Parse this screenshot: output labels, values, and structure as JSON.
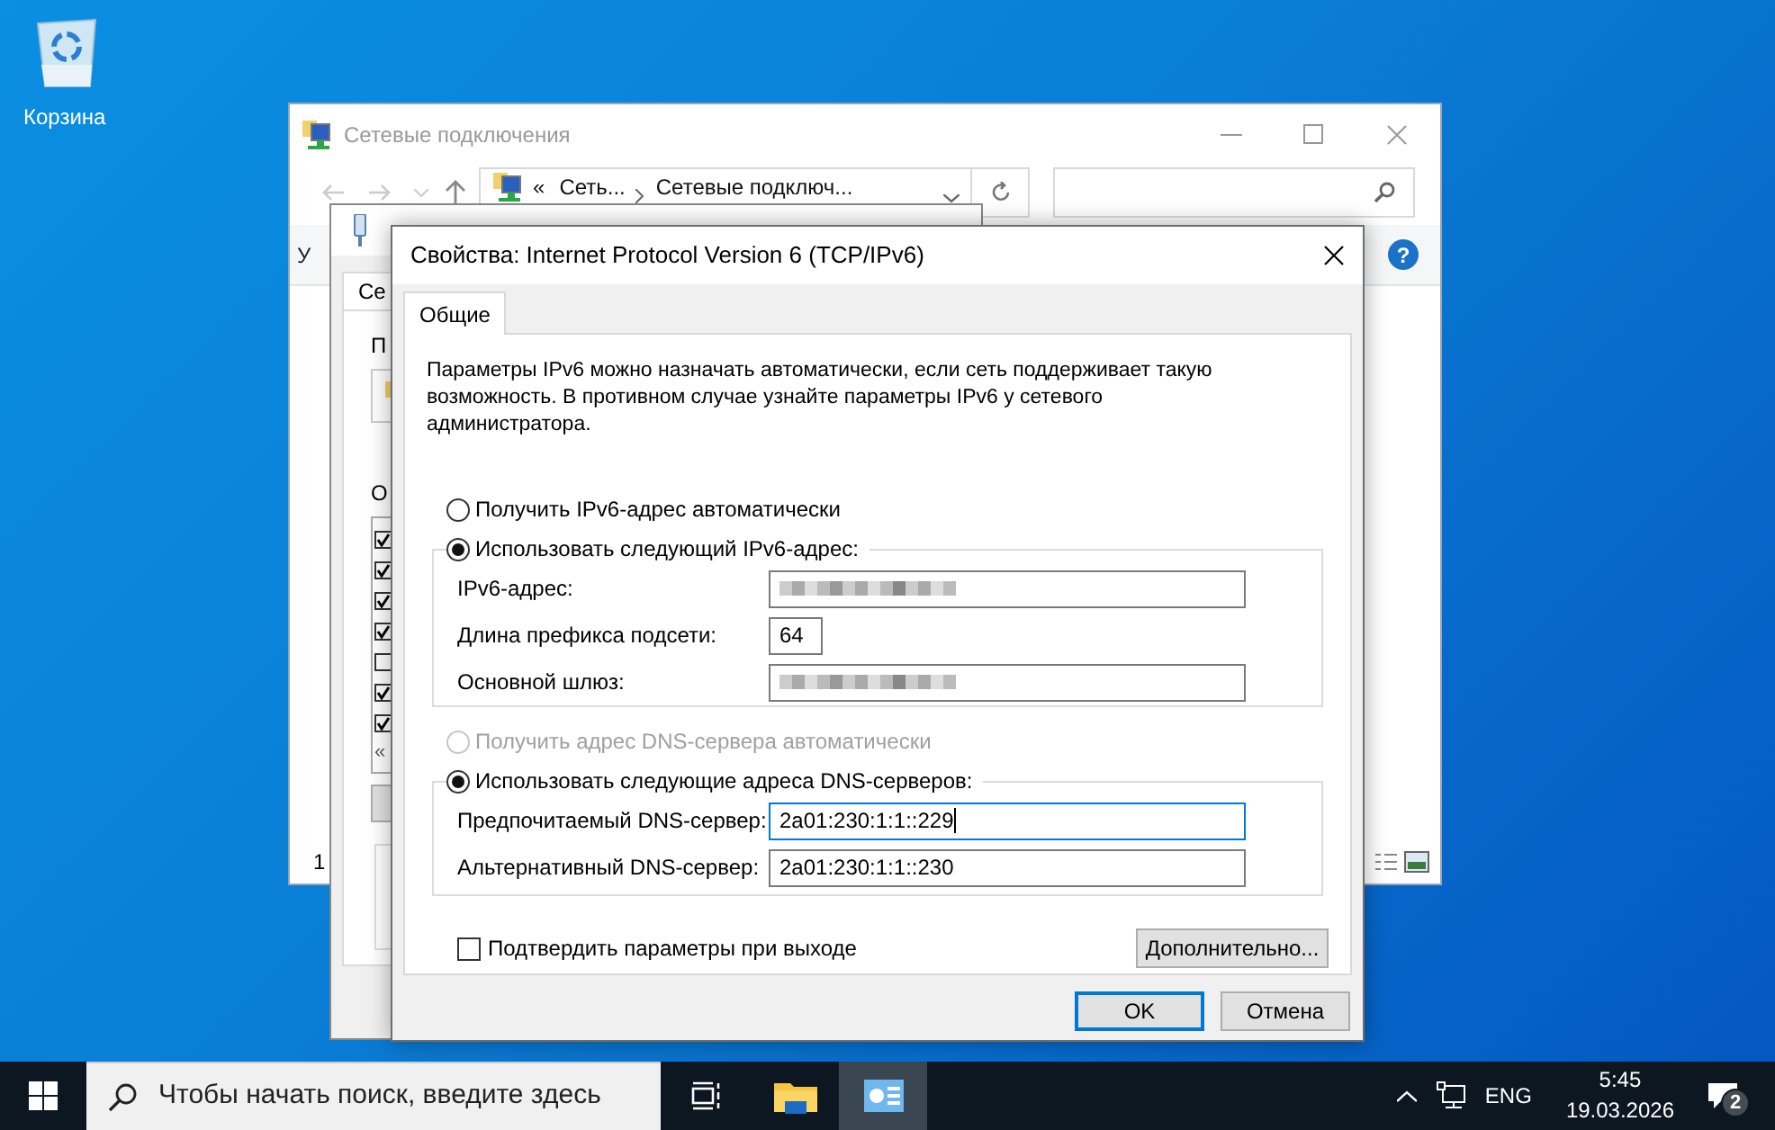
{
  "desktop": {
    "icons": [
      {
        "label": "Корзина"
      }
    ]
  },
  "explorer": {
    "title": "Сетевые подключения",
    "breadcrumb_prefix": "«",
    "breadcrumb": [
      "Сеть...",
      "Сетевые подключ..."
    ],
    "ribbon_label": "У",
    "help_glyph": "?",
    "status_text": "1"
  },
  "adapter_window": {
    "tab": "Се",
    "connect_label": "П",
    "components_label": "О",
    "components": [
      {
        "checked": true
      },
      {
        "checked": true
      },
      {
        "checked": true
      },
      {
        "checked": true
      },
      {
        "checked": false
      },
      {
        "checked": true
      },
      {
        "checked": true
      }
    ],
    "scroll_glyph": "«"
  },
  "dialog": {
    "title": "Свойства: Internet Protocol Version 6 (TCP/IPv6)",
    "tabs": [
      {
        "label": "Общие",
        "selected": true
      }
    ],
    "description": "Параметры IPv6 можно назначать автоматически, если сеть поддерживает такую возможность. В противном случае узнайте параметры IPv6 у сетевого администратора.",
    "address_options": [
      {
        "label": "Получить IPv6-адрес автоматически",
        "selected": false,
        "disabled": false
      },
      {
        "label": "Использовать следующий IPv6-адрес:",
        "selected": true,
        "disabled": false
      }
    ],
    "address_fields": [
      {
        "label": "IPv6-адрес:",
        "redacted": true,
        "kind": "wide"
      },
      {
        "label": "Длина префикса подсети:",
        "value": "64",
        "kind": "short"
      },
      {
        "label": "Основной шлюз:",
        "redacted": true,
        "kind": "wide"
      }
    ],
    "dns_options": [
      {
        "label": "Получить адрес DNS-сервера автоматически",
        "selected": false,
        "disabled": true
      },
      {
        "label": "Использовать следующие адреса DNS-серверов:",
        "selected": true,
        "disabled": false
      }
    ],
    "dns_fields": [
      {
        "label": "Предпочитаемый DNS-сервер:",
        "value": "2a01:230:1:1::229",
        "focused": true,
        "kind": "wide"
      },
      {
        "label": "Альтернативный DNS-сервер:",
        "value": "2a01:230:1:1::230",
        "focused": false,
        "kind": "wide"
      }
    ],
    "validate_on_exit": {
      "label": "Подтвердить параметры при выходе",
      "checked": false
    },
    "advanced_button": "Дополнительно...",
    "buttons": [
      {
        "label": "OK",
        "default": true
      },
      {
        "label": "Отмена",
        "default": false
      }
    ]
  },
  "taskbar": {
    "search_placeholder": "Чтобы начать поиск, введите здесь",
    "apps": [
      {
        "kind": "task-view",
        "active": false
      },
      {
        "kind": "explorer",
        "active": false
      },
      {
        "kind": "network",
        "active": true
      }
    ],
    "language": "ENG",
    "time": "5:45",
    "date": "19.03.2026",
    "notification_count": "2"
  }
}
